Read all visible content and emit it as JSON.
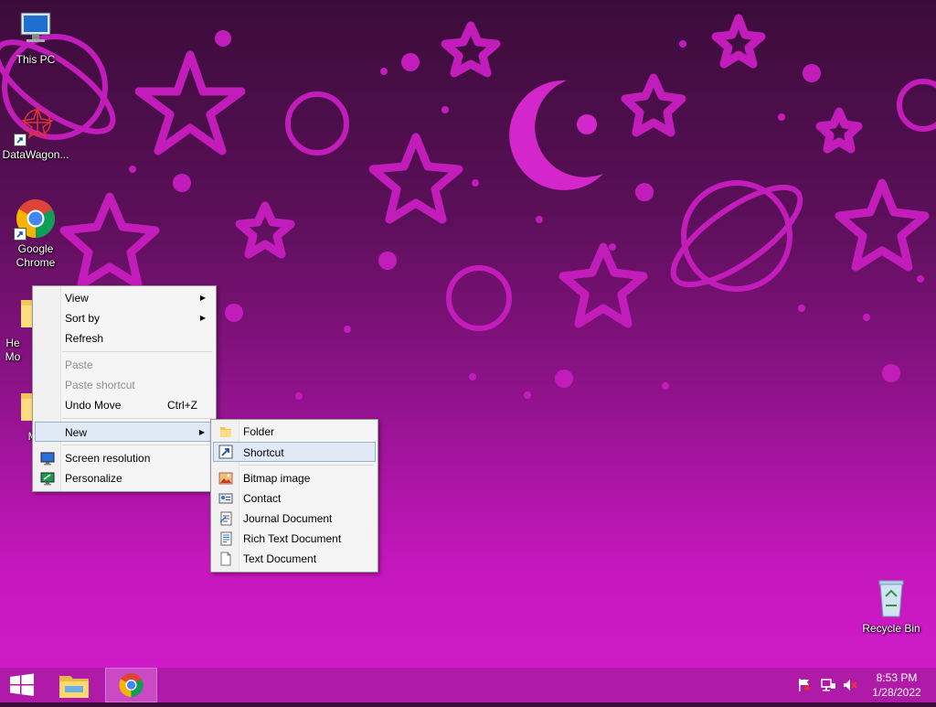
{
  "desktop": {
    "icons": [
      {
        "label": "This PC",
        "icon": "computer-icon"
      },
      {
        "label": "DataWagon...",
        "icon": "datawagon-icon"
      },
      {
        "label": "Google Chrome",
        "icon": "chrome-icon"
      },
      {
        "label": "He Mo",
        "icon": "folder-icon"
      },
      {
        "label": "Me",
        "icon": "folder-icon"
      },
      {
        "label": "Recycle Bin",
        "icon": "recycle-bin-icon"
      }
    ]
  },
  "context_menu": {
    "items": [
      {
        "label": "View",
        "submenu": true
      },
      {
        "label": "Sort by",
        "submenu": true
      },
      {
        "label": "Refresh"
      },
      {
        "label": "Paste",
        "disabled": true
      },
      {
        "label": "Paste shortcut",
        "disabled": true
      },
      {
        "label": "Undo Move",
        "shortcut": "Ctrl+Z"
      },
      {
        "label": "New",
        "submenu": true,
        "highlighted": true
      },
      {
        "label": "Screen resolution",
        "icon": "screen-resolution-icon"
      },
      {
        "label": "Personalize",
        "icon": "personalize-icon"
      }
    ]
  },
  "new_submenu": {
    "items": [
      {
        "label": "Folder",
        "icon": "folder-icon"
      },
      {
        "label": "Shortcut",
        "icon": "shortcut-icon",
        "highlighted": true
      },
      {
        "label": "Bitmap image",
        "icon": "bitmap-icon"
      },
      {
        "label": "Contact",
        "icon": "contact-icon"
      },
      {
        "label": "Journal Document",
        "icon": "journal-icon"
      },
      {
        "label": "Rich Text Document",
        "icon": "rtf-icon"
      },
      {
        "label": "Text Document",
        "icon": "text-document-icon"
      }
    ]
  },
  "taskbar": {
    "start": "windows-logo-icon",
    "pinned": [
      "file-explorer-icon",
      "chrome-icon"
    ],
    "tray": {
      "time": "8:53 PM",
      "date": "1/28/2022"
    }
  },
  "colors": {
    "taskbar": "#b01aa8",
    "wallpaper_motif": "#c91fc0",
    "menu_highlight": "#dfeaf6"
  }
}
